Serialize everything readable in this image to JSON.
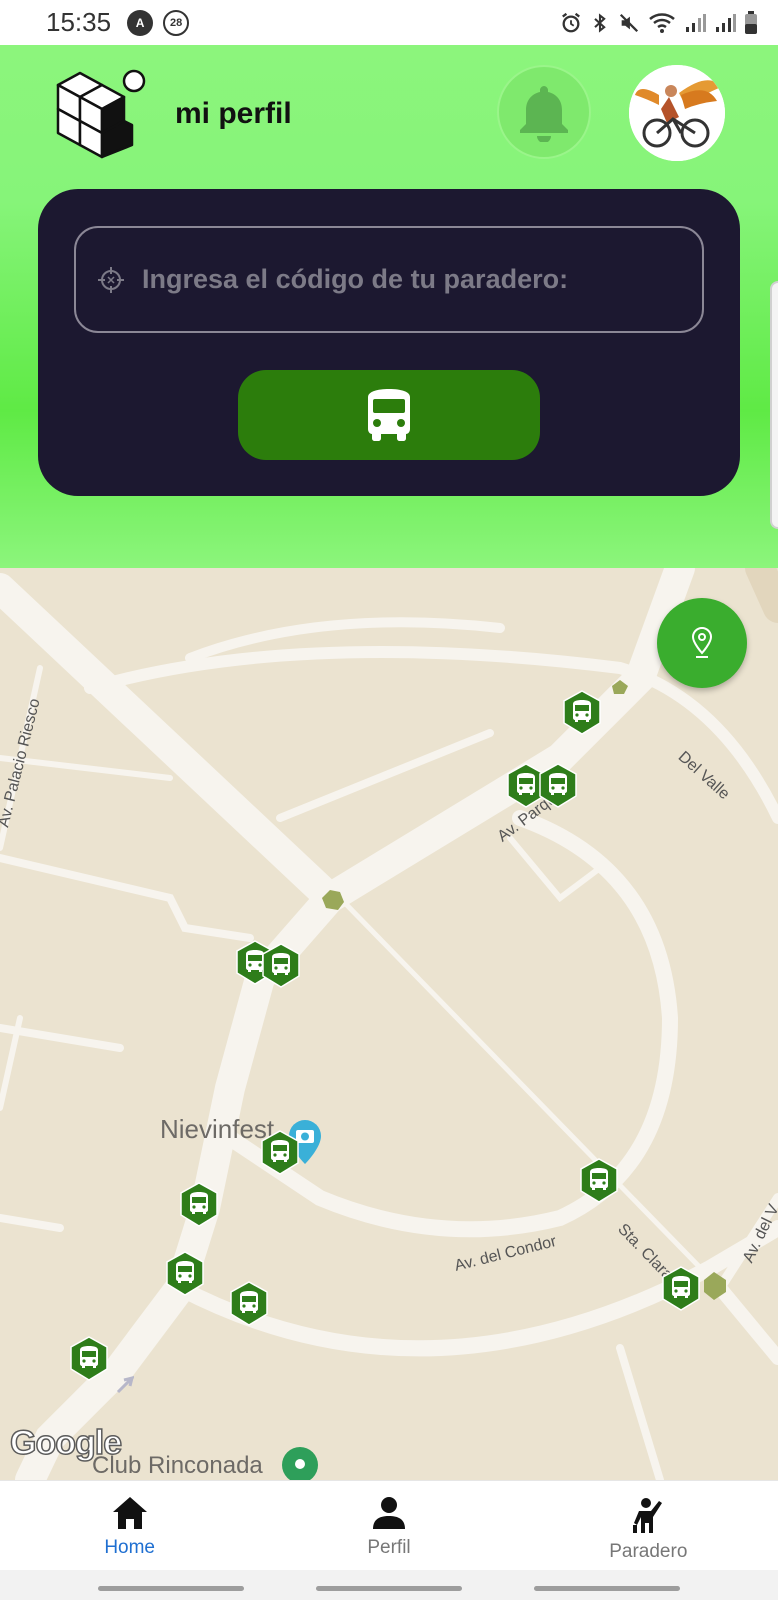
{
  "status_bar": {
    "time": "15:35",
    "badge_a": "A",
    "badge_count": "28",
    "icons": [
      "alarm-icon",
      "bluetooth-icon",
      "mute-icon",
      "wifi-icon",
      "signal-icon",
      "signal-icon",
      "battery-icon"
    ]
  },
  "header": {
    "title": "mi perfil",
    "logo": "cubes-logo",
    "bell": "bell-icon",
    "avatar": "avatar-cyclist"
  },
  "search": {
    "placeholder": "Ingresa el código de tu paradero:",
    "value": "",
    "button_icon": "bus-icon"
  },
  "colors": {
    "header_green": "#86f479",
    "card_dark": "#1c1830",
    "button_green": "#2c7d0c",
    "marker_green": "#2e7d1a",
    "locate_green": "#3aad2e",
    "nav_active": "#1f6fd1"
  },
  "map": {
    "road_labels": [
      "Av. Parque",
      "Del Valle",
      "Av. Palacio Riesco",
      "Av. del Condor",
      "Sta. Clara",
      "Av. del V"
    ],
    "poi": "Nievinfest",
    "club": "Club Rinconada",
    "attribution": "Google",
    "bus_stop_count": 13
  },
  "nav": {
    "items": [
      {
        "label": "Home",
        "icon": "home-icon",
        "active": true
      },
      {
        "label": "Perfil",
        "icon": "person-icon",
        "active": false
      },
      {
        "label": "Paradero",
        "icon": "waving-person-icon",
        "active": false
      }
    ]
  }
}
